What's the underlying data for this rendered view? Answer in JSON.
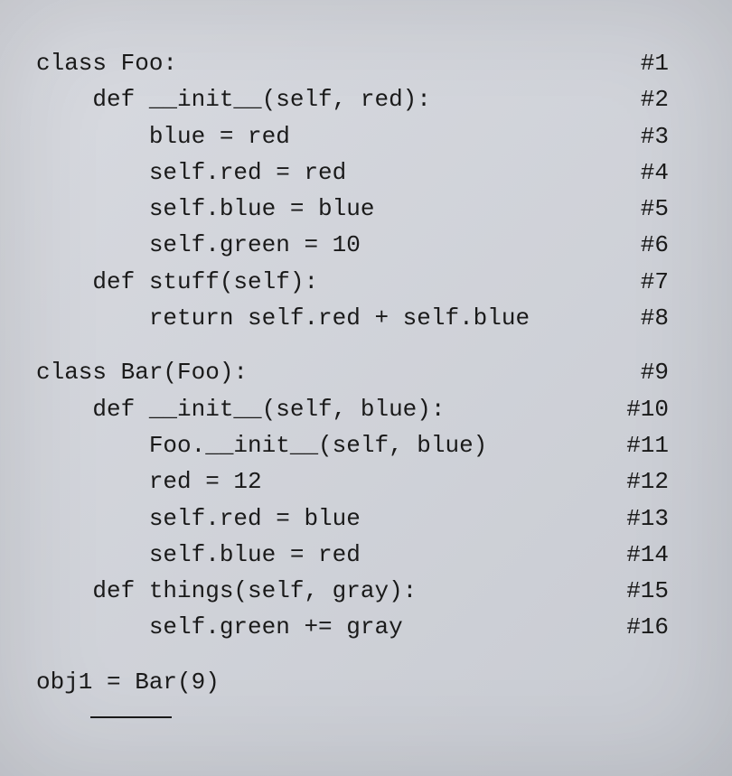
{
  "lines": [
    {
      "text": "class Foo:",
      "annotation": "#1"
    },
    {
      "text": "    def __init__(self, red):",
      "annotation": "#2"
    },
    {
      "text": "        blue = red",
      "annotation": "#3"
    },
    {
      "text": "        self.red = red",
      "annotation": "#4"
    },
    {
      "text": "        self.blue = blue",
      "annotation": "#5"
    },
    {
      "text": "        self.green = 10",
      "annotation": "#6"
    },
    {
      "text": "    def stuff(self):",
      "annotation": "#7"
    },
    {
      "text": "        return self.red + self.blue",
      "annotation": "#8"
    },
    {
      "spacer": true
    },
    {
      "text": "class Bar(Foo):",
      "annotation": "#9"
    },
    {
      "text": "    def __init__(self, blue):",
      "annotation": "#10"
    },
    {
      "text": "        Foo.__init__(self, blue)",
      "annotation": "#11"
    },
    {
      "text": "        red = 12",
      "annotation": "#12"
    },
    {
      "text": "        self.red = blue",
      "annotation": "#13"
    },
    {
      "text": "        self.blue = red",
      "annotation": "#14"
    },
    {
      "text": "    def things(self, gray):",
      "annotation": "#15"
    },
    {
      "text": "        self.green += gray",
      "annotation": "#16"
    },
    {
      "spacer": true
    },
    {
      "text": "obj1 = Bar(9)",
      "annotation": ""
    }
  ]
}
